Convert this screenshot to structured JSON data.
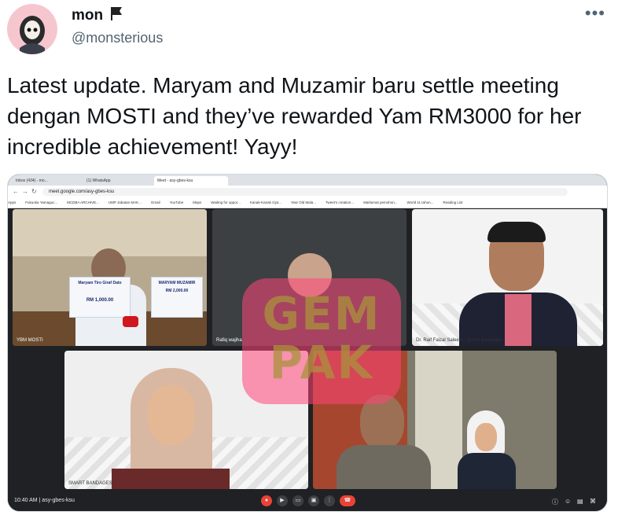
{
  "author": {
    "display_name": "mon",
    "handle": "@monsterious",
    "flag_icon": "flag-icon"
  },
  "more_label": "•••",
  "tweet": {
    "text": "Latest update. Maryam and Muzamir baru settle meeting dengan MOSTI and they’ve rewarded Yam RM3000 for her incredible achievement! Yayy!"
  },
  "screenshot": {
    "url": "meet.google.com/asy-gbes-ksu",
    "bookmarks": [
      "Apps",
      "Fukuoka Yamaguc...",
      "MCDBA ARCHIVE...",
      "UMP Jabatan MAK...",
      "Gmail",
      "YouTube",
      "Maps",
      "Waiting for oppor...",
      "Kanak-Kanak Cipt...",
      "Year Old Mala...",
      "Tweet's creation...",
      "Maklumat pemohon...",
      "World 11 tahun...",
      "Reading List"
    ],
    "tabs": [
      "Inbox (434) - mo...",
      "(1) WhatsApp",
      "Meet - asy-gbes-ksu"
    ],
    "participants": [
      "YBM MOSTI",
      "Rafiq wajiha",
      "Dr. Raif Faizal Saleem - Smart Bandages",
      "SMART BANDAGES",
      ""
    ],
    "signs": [
      "Maryam Tiro Giraf Dato",
      "MARYAM MUZAMIR",
      "RM 1,000.00",
      "RM 2,000.00"
    ],
    "watermark": "GEM PAK",
    "time": "10:40 AM",
    "meeting_code": "asy-gbes-ksu"
  }
}
